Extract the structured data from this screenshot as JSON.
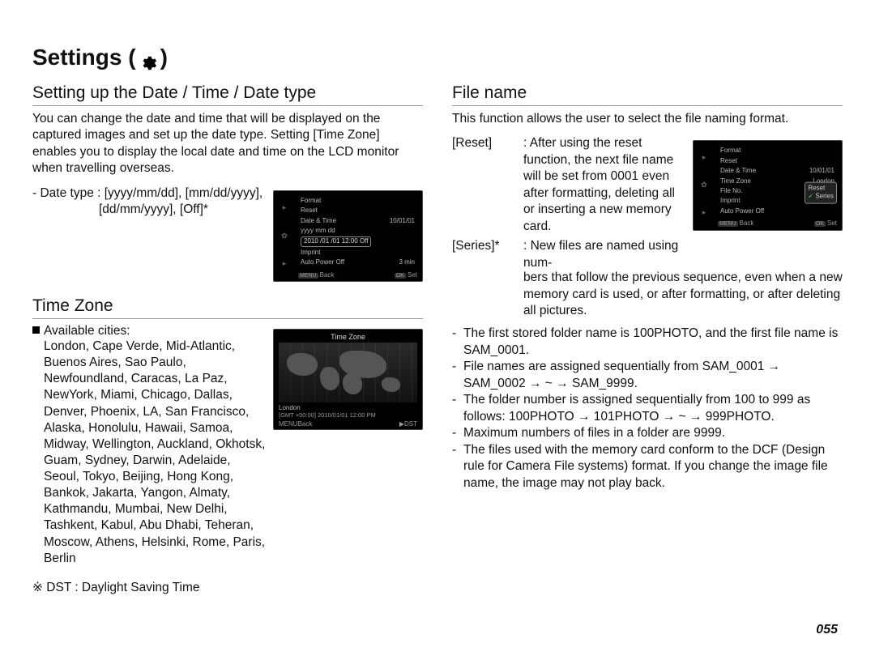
{
  "title_prefix": "Settings (",
  "title_suffix": " )",
  "pageNumber": "055",
  "leftColumn": {
    "datetime": {
      "heading": "Setting up the Date / Time / Date type",
      "intro": "You can change the date and time that will be displayed on the captured images and set up the date type. Setting [Time Zone] enables you to display the local date and time on the LCD monitor when travelling overseas.",
      "dateTypeLine1": "- Date type : [yyyy/mm/dd], [mm/dd/yyyy],",
      "dateTypeLine2": "[dd/mm/yyyy], [Off]*",
      "lcd": {
        "items": [
          {
            "label": "Format"
          },
          {
            "label": "Reset"
          },
          {
            "label": "Date & Time",
            "value": "10/01/01"
          },
          {
            "label": "yyyy mm dd"
          },
          {
            "label": "2010 /01 /01   12:00   Off",
            "boxed": true
          },
          {
            "label": "Imprint"
          },
          {
            "label": "Auto Power Off",
            "value": "3 min"
          }
        ],
        "footerLeft": "MENU  Back",
        "footerRight": "OK  Set"
      }
    },
    "timezone": {
      "heading": "Time Zone",
      "citiesLabel": "Available cities:",
      "cities": "London, Cape Verde, Mid-Atlantic, Buenos Aires, Sao Paulo, Newfoundland, Caracas, La Paz, NewYork, Miami, Chicago, Dallas, Denver, Phoenix, LA, San Francisco, Alaska, Honolulu, Hawaii, Samoa, Midway, Wellington, Auckland, Okhotsk, Guam, Sydney, Darwin, Adelaide, Seoul, Tokyo, Beijing, Hong Kong, Bankok, Jakarta, Yangon, Almaty, Kathmandu, Mumbai, New Delhi, Tashkent, Kabul, Abu Dhabi, Teheran, Moscow, Athens, Helsinki, Rome, Paris, Berlin",
      "dstNote": "※ DST : Daylight Saving Time",
      "lcd": {
        "title": "Time Zone",
        "infoLeft": "London",
        "infoRight": "",
        "gmtLine": "[GMT +00:00]    2010/01/01    12:00 PM",
        "footerLeft": "MENU  Back",
        "footerRight": "▶  DST"
      }
    }
  },
  "rightColumn": {
    "filename": {
      "heading": "File name",
      "intro": "This function allows the user to select the file naming format.",
      "defs": {
        "resetLabel": "[Reset]",
        "resetText": ": After using the reset function, the next file name will be set from 0001 even after formatting, deleting all or inserting a new memory card.",
        "seriesLabel": "[Series]*",
        "seriesLead": ": New files are named using num-",
        "seriesRest": "bers that follow the previous sequence, even when a new memory card is used, or after formatting, or after deleting all pictures."
      },
      "bullets": [
        "The first stored folder name is 100PHOTO, and the first file name is SAM_0001.",
        "File names are assigned sequentially from SAM_0001 → SAM_0002 → ~ → SAM_9999.",
        "The folder number is assigned sequentially from 100 to 999 as follows: 100PHOTO → 101PHOTO → ~ → 999PHOTO.",
        "Maximum numbers of files in a folder are 9999.",
        "The files used with the memory card conform to the DCF (Design rule for Camera File systems) format. If you change the image file name, the image may not play back."
      ],
      "lcd": {
        "items": [
          {
            "label": "Format"
          },
          {
            "label": "Reset"
          },
          {
            "label": "Date & Time",
            "value": "10/01/01"
          },
          {
            "label": "Time Zone",
            "value": "London"
          },
          {
            "label": "File No.",
            "value": "▶"
          },
          {
            "label": "Imprint"
          },
          {
            "label": "Auto Power Off"
          }
        ],
        "popup": [
          "Reset",
          "Series"
        ],
        "footerLeft": "MENU  Back",
        "footerRight": "OK  Set"
      }
    }
  }
}
